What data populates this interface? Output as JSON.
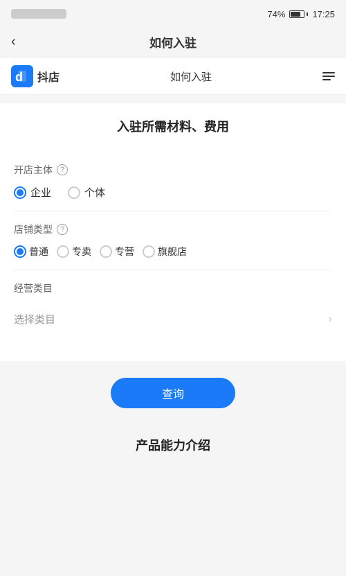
{
  "statusBar": {
    "battery": "74%",
    "time": "17:25"
  },
  "navBar": {
    "backLabel": "‹",
    "title": "如何入驻"
  },
  "appHeader": {
    "logoText": "抖店",
    "centerTitle": "如何入驻",
    "menuAriaLabel": "menu"
  },
  "mainSection": {
    "sectionTitle": "入驻所需材料、费用",
    "ownerType": {
      "label": "开店主体",
      "options": [
        {
          "id": "enterprise",
          "label": "企业",
          "checked": true
        },
        {
          "id": "individual",
          "label": "个体",
          "checked": false
        }
      ]
    },
    "storeType": {
      "label": "店铺类型",
      "options": [
        {
          "id": "normal",
          "label": "普通",
          "checked": true
        },
        {
          "id": "exclusive",
          "label": "专卖",
          "checked": false
        },
        {
          "id": "special",
          "label": "专营",
          "checked": false
        },
        {
          "id": "flagship",
          "label": "旗舰店",
          "checked": false
        }
      ]
    },
    "category": {
      "label": "经营类目",
      "placeholder": "选择类目"
    },
    "queryButton": "查询"
  },
  "bottomSection": {
    "title": "产品能力介绍"
  }
}
